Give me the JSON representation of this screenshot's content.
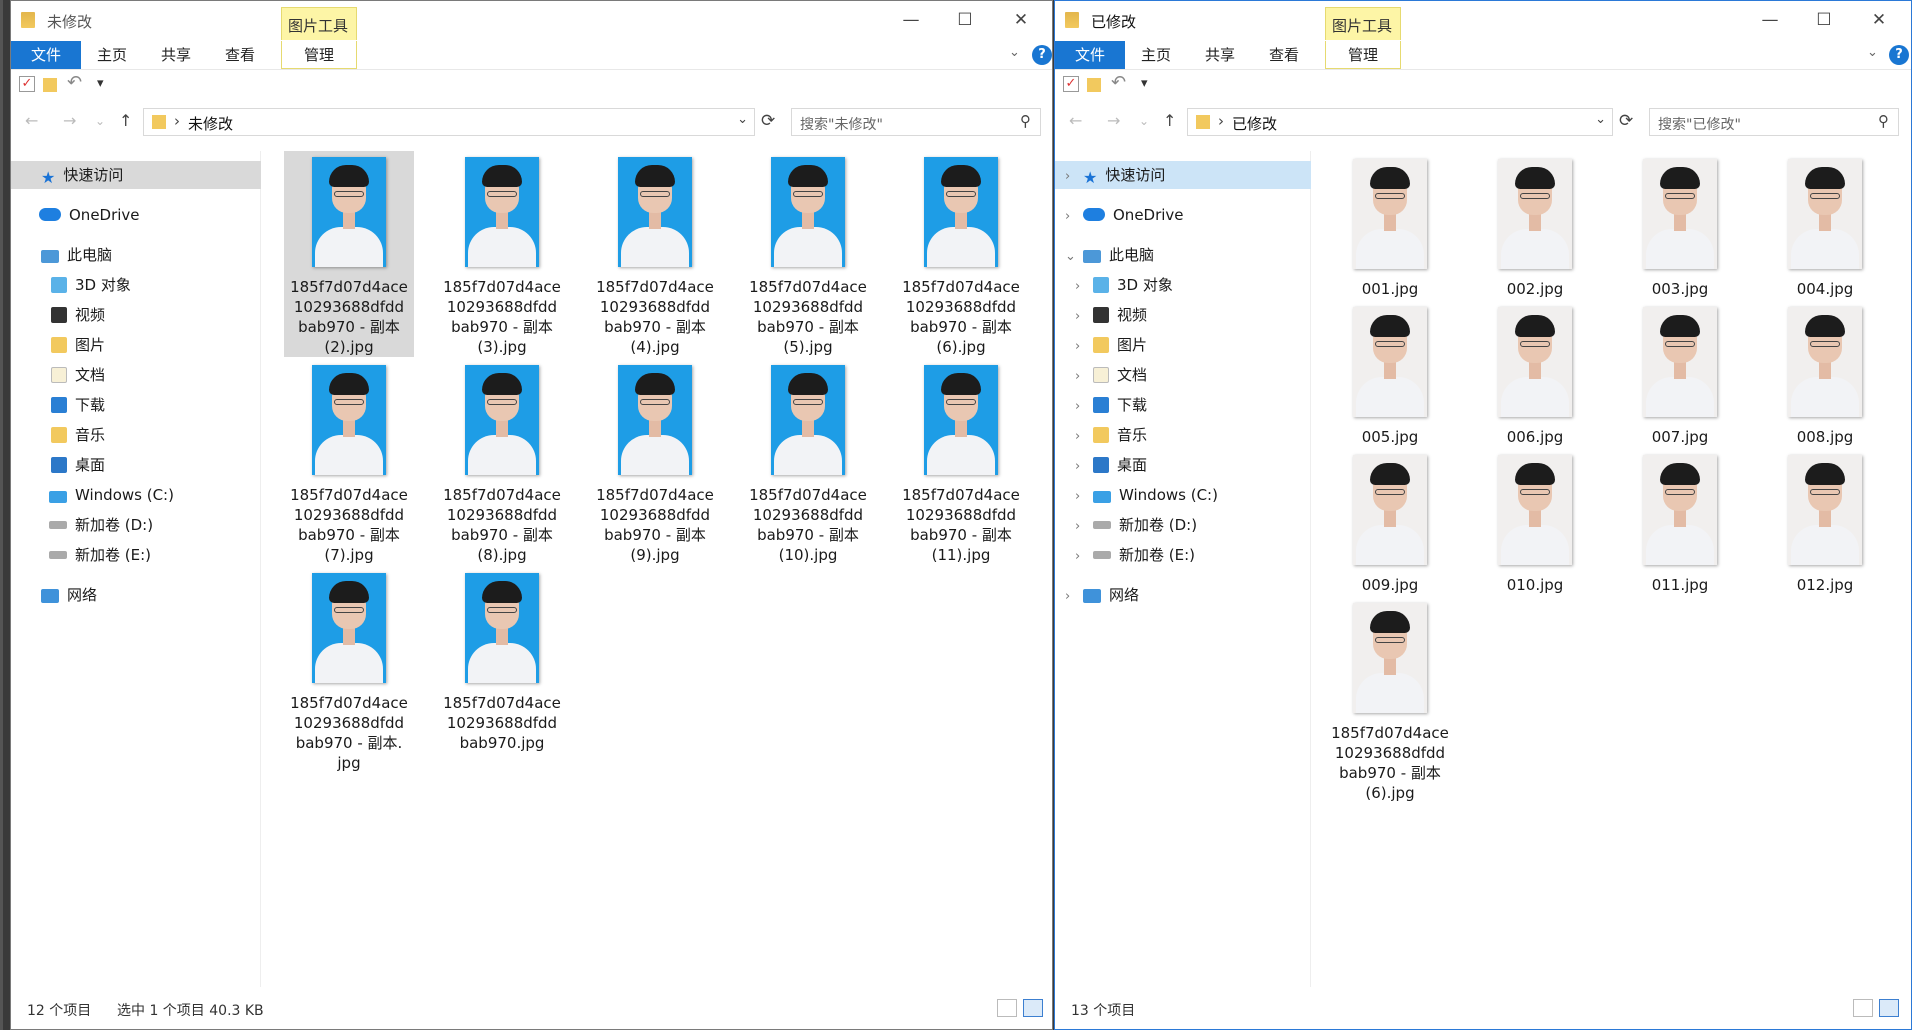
{
  "left_window": {
    "title": "未修改",
    "context_tab": "图片工具",
    "ribbon_tabs": [
      "文件",
      "主页",
      "共享",
      "查看",
      "管理"
    ],
    "address": "未修改",
    "search_placeholder": "搜索\"未修改\"",
    "nav": [
      "快速访问",
      "OneDrive",
      "此电脑",
      "3D 对象",
      "视频",
      "图片",
      "文档",
      "下载",
      "音乐",
      "桌面",
      "Windows (C:)",
      "新加卷 (D:)",
      "新加卷 (E:)",
      "网络"
    ],
    "files": [
      "185f7d07d4ace\n10293688dfdd\nbab970 - 副本\n(2).jpg",
      "185f7d07d4ace\n10293688dfdd\nbab970 - 副本\n(3).jpg",
      "185f7d07d4ace\n10293688dfdd\nbab970 - 副本\n(4).jpg",
      "185f7d07d4ace\n10293688dfdd\nbab970 - 副本\n(5).jpg",
      "185f7d07d4ace\n10293688dfdd\nbab970 - 副本\n(6).jpg",
      "185f7d07d4ace\n10293688dfdd\nbab970 - 副本\n(7).jpg",
      "185f7d07d4ace\n10293688dfdd\nbab970 - 副本\n(8).jpg",
      "185f7d07d4ace\n10293688dfdd\nbab970 - 副本\n(9).jpg",
      "185f7d07d4ace\n10293688dfdd\nbab970 - 副本\n(10).jpg",
      "185f7d07d4ace\n10293688dfdd\nbab970 - 副本\n(11).jpg",
      "185f7d07d4ace\n10293688dfdd\nbab970 - 副本.\njpg",
      "185f7d07d4ace\n10293688dfdd\nbab970.jpg"
    ],
    "status_count": "12 个项目",
    "status_selected": "选中 1 个项目  40.3 KB"
  },
  "right_window": {
    "title": "已修改",
    "context_tab": "图片工具",
    "ribbon_tabs": [
      "文件",
      "主页",
      "共享",
      "查看",
      "管理"
    ],
    "address": "已修改",
    "search_placeholder": "搜索\"已修改\"",
    "nav": [
      "快速访问",
      "OneDrive",
      "此电脑",
      "3D 对象",
      "视频",
      "图片",
      "文档",
      "下载",
      "音乐",
      "桌面",
      "Windows (C:)",
      "新加卷 (D:)",
      "新加卷 (E:)",
      "网络"
    ],
    "files": [
      "001.jpg",
      "002.jpg",
      "003.jpg",
      "004.jpg",
      "005.jpg",
      "006.jpg",
      "007.jpg",
      "008.jpg",
      "009.jpg",
      "010.jpg",
      "011.jpg",
      "012.jpg",
      "185f7d07d4ace\n10293688dfdd\nbab970 - 副本\n(6).jpg"
    ],
    "status_count": "13 个项目"
  },
  "icons": {
    "window_min": "minimize-icon",
    "window_max": "maximize-icon",
    "window_close": "close-icon",
    "help": "help-icon",
    "search": "search-icon",
    "refresh": "refresh-icon"
  }
}
